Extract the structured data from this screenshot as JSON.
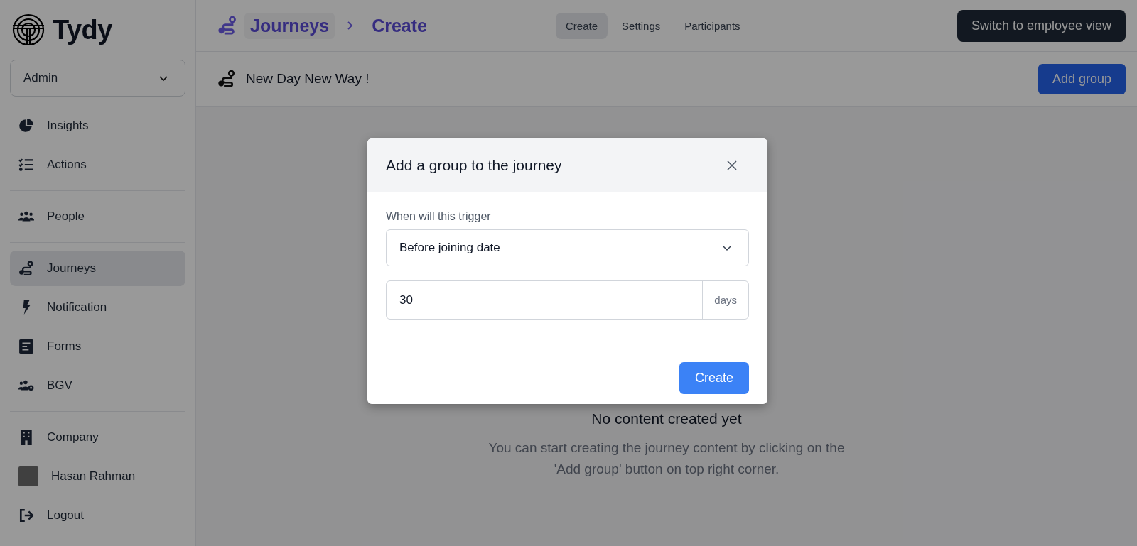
{
  "brand": {
    "name": "Tydy"
  },
  "role_select": {
    "value": "Admin"
  },
  "sidebar": {
    "sections": [
      [
        {
          "label": "Insights",
          "selected": false
        },
        {
          "label": "Actions",
          "selected": false
        }
      ],
      [
        {
          "label": "People",
          "selected": false
        }
      ],
      [
        {
          "label": "Journeys",
          "selected": true
        },
        {
          "label": "Notification",
          "selected": false
        },
        {
          "label": "Forms",
          "selected": false
        },
        {
          "label": "BGV",
          "selected": false
        }
      ],
      [
        {
          "label": "Company",
          "selected": false
        },
        {
          "label": "Hasan Rahman",
          "selected": false
        },
        {
          "label": "Logout",
          "selected": false
        }
      ]
    ]
  },
  "breadcrumb": [
    "Journeys",
    "Create"
  ],
  "tabs": [
    {
      "label": "Create",
      "selected": true
    },
    {
      "label": "Settings",
      "selected": false
    },
    {
      "label": "Participants",
      "selected": false
    }
  ],
  "switch_button": "Switch to employee view",
  "journey": {
    "title": "New Day New Way !",
    "add_button": "Add group"
  },
  "empty_state": {
    "title": "No content created yet",
    "message": "You can start creating the journey content by clicking on the 'Add group' button on top right corner."
  },
  "modal": {
    "title": "Add a group to the journey",
    "trigger_label": "When will this trigger",
    "trigger_value": "Before joining date",
    "days_value": "30",
    "days_unit": "days",
    "create_button": "Create"
  }
}
